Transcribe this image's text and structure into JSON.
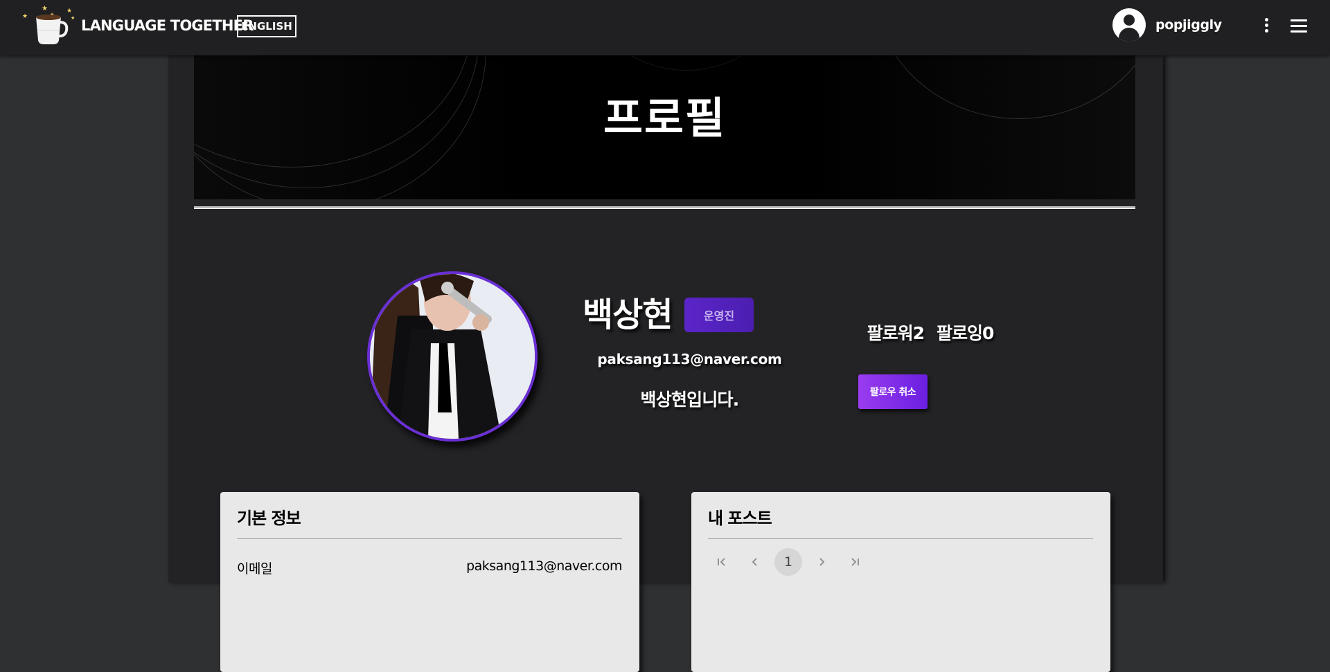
{
  "header": {
    "brand": "LANGUAGE TOGETHER",
    "language_button": "ENGLISH",
    "username": "popjiggly",
    "icons": [
      "coffee-cup-logo",
      "account-circle-icon",
      "more-vert-icon",
      "menu-icon"
    ]
  },
  "banner": {
    "title": "프로필"
  },
  "profile": {
    "name": "백상현",
    "role_badge": "운영진",
    "email": "paksang113@naver.com",
    "bio": "백상현입니다.",
    "followers_label": "팔로워2",
    "following_label": "팔로잉0",
    "unfollow_button": "팔로우 취소"
  },
  "basic_info": {
    "title": "기본 정보",
    "rows": [
      {
        "label": "이메일",
        "value": "paksang113@naver.com"
      }
    ]
  },
  "my_posts": {
    "title": "내 포스트",
    "pagination": {
      "current_page": "1"
    }
  },
  "colors": {
    "accent_purple": "#6a2fd4",
    "button_gradient_start": "#9a3cf0",
    "topbar_bg": "#202022",
    "page_bg": "#2f3032"
  }
}
